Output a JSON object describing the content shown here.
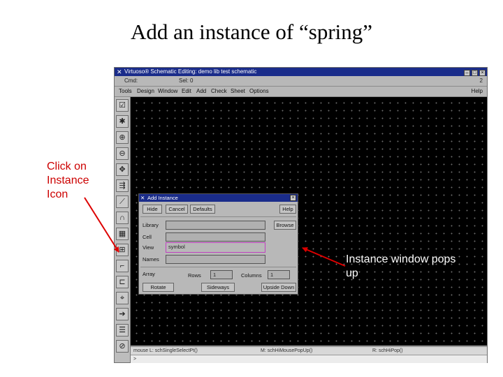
{
  "slide": {
    "title": "Add an instance of “spring”",
    "callout_left": "Click on Instance Icon",
    "callout_right": "Instance window pops up"
  },
  "app": {
    "window_title": "Virtuoso® Schematic Editing: demo lib test schematic",
    "status": {
      "cmd_label": "Cmd:",
      "sel_label": "Sel: 0",
      "right_num": "2"
    },
    "menus": [
      "Tools",
      "Design",
      "Window",
      "Edit",
      "Add",
      "Check",
      "Sheet",
      "Options"
    ],
    "help": "Help",
    "prompt_left": "mouse L: schSingleSelectPt()",
    "prompt_mid": "M: schHiMousePopUp()",
    "prompt_right": "R: schHiPop()",
    "command_line": ">",
    "colors": {
      "titlebar": "#1a2c8a",
      "canvas": "#000000",
      "callout_left": "#cc0000",
      "arrow": "#dd0000"
    }
  },
  "toolbar": {
    "icons": [
      "check-icon",
      "magic-icon",
      "zoom-in-icon",
      "zoom-out-icon",
      "stretch-icon",
      "copy-icon",
      "wire-icon",
      "undo-icon",
      "grid-icon",
      "instance-icon",
      "bend-icon",
      "pin-icon",
      "property-icon",
      "arrow-icon",
      "label-icon",
      "delete-icon"
    ]
  },
  "dialog": {
    "title": "Add Instance",
    "buttons": {
      "hide": "Hide",
      "cancel": "Cancel",
      "defaults": "Defaults",
      "help": "Help",
      "browse": "Browse"
    },
    "fields": {
      "library_label": "Library",
      "library_value": "",
      "cell_label": "Cell",
      "cell_value": "",
      "view_label": "View",
      "view_value": "symbol",
      "names_label": "Names",
      "names_value": ""
    },
    "array": {
      "label": "Array",
      "rows_label": "Rows",
      "rows_value": "1",
      "columns_label": "Columns",
      "columns_value": "1"
    },
    "actions": {
      "rotate": "Rotate",
      "sideways": "Sideways",
      "upside_down": "Upside Down"
    }
  }
}
